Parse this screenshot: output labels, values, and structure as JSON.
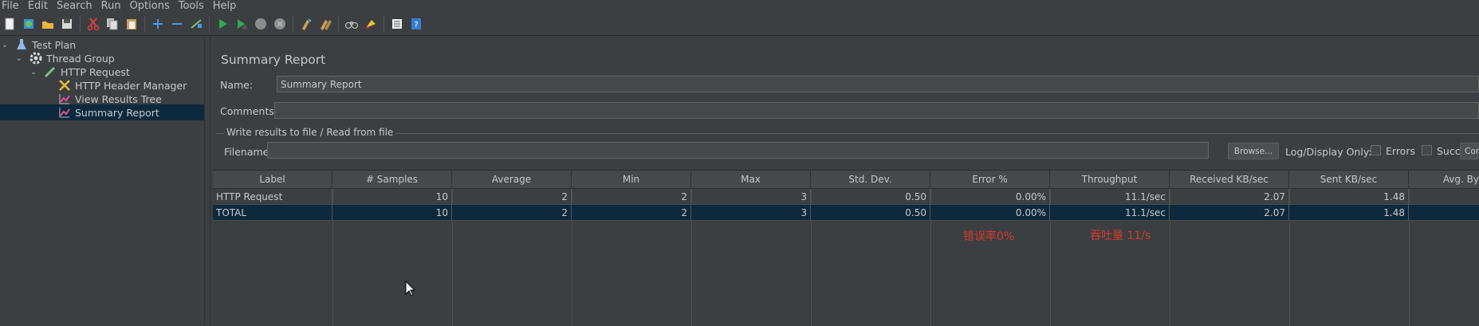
{
  "menu": [
    "File",
    "Edit",
    "Search",
    "Run",
    "Options",
    "Tools",
    "Help"
  ],
  "toolbar": [
    "new-icon",
    "templates-icon",
    "open-icon",
    "save-icon",
    "cut-icon",
    "copy-icon",
    "paste-icon",
    "expand-icon",
    "collapse-icon",
    "toggle-icon",
    "start-icon",
    "start-no-pause-icon",
    "stop-icon",
    "shutdown-icon",
    "clear-icon",
    "clear-all-icon",
    "search-icon",
    "reset-search-icon",
    "function-helper-icon",
    "help-icon"
  ],
  "tree": {
    "items": [
      {
        "label": "Test Plan"
      },
      {
        "label": "Thread Group"
      },
      {
        "label": "HTTP Request"
      },
      {
        "label": "HTTP Header Manager"
      },
      {
        "label": "View Results Tree"
      },
      {
        "label": "Summary Report"
      }
    ]
  },
  "panel": {
    "title": "Summary Report",
    "name_label": "Name:",
    "name_value": "Summary Report",
    "comments_label": "Comments:",
    "comments_value": "",
    "file_group": "Write results to file / Read from file",
    "filename_label": "Filename",
    "filename_value": "",
    "browse_label": "Browse...",
    "log_display_label": "Log/Display Only:",
    "errors_label": "Errors",
    "successes_label": "Successes",
    "configure_label": "Con"
  },
  "table": {
    "columns": [
      "Label",
      "# Samples",
      "Average",
      "Min",
      "Max",
      "Std. Dev.",
      "Error %",
      "Throughput",
      "Received KB/sec",
      "Sent KB/sec",
      "Avg. By"
    ],
    "rows": [
      [
        "HTTP Request",
        "10",
        "2",
        "2",
        "3",
        "0.50",
        "0.00%",
        "11.1/sec",
        "2.07",
        "1.48",
        ""
      ],
      [
        "TOTAL",
        "10",
        "2",
        "2",
        "3",
        "0.50",
        "0.00%",
        "11.1/sec",
        "2.07",
        "1.48",
        ""
      ]
    ]
  },
  "annotations": {
    "error_rate": "错误率0%",
    "throughput": "吞吐量 11/s"
  }
}
